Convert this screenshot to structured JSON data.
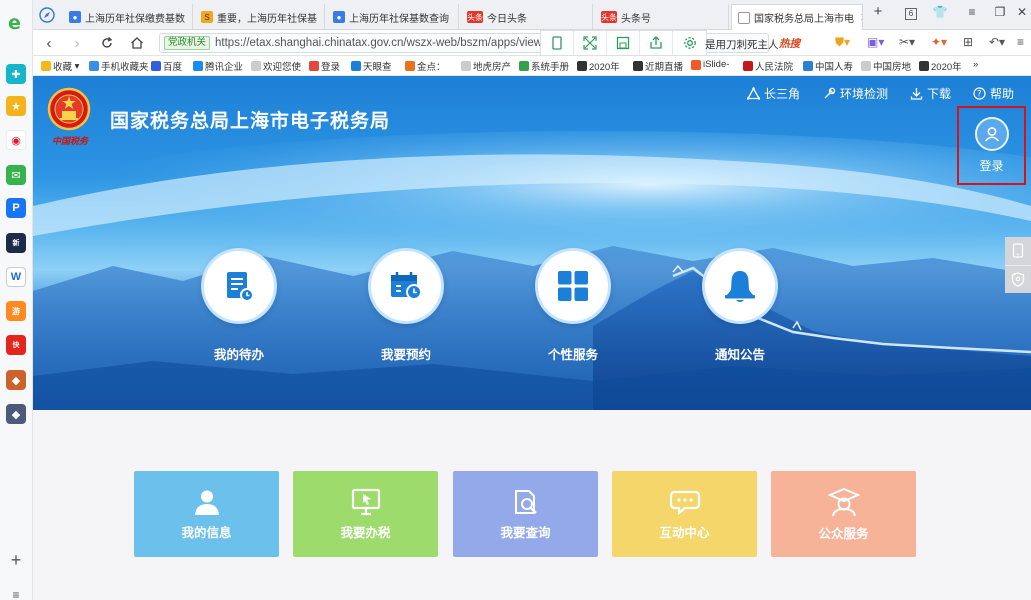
{
  "browser": {
    "tabs": [
      {
        "title": "上海历年社保缴费基数"
      },
      {
        "title": "重要，上海历年社保基"
      },
      {
        "title": "上海历年社保基数查询"
      },
      {
        "title": "今日头条",
        "badge": "头条"
      },
      {
        "title": "头条号",
        "badge": "头条"
      },
      {
        "title": "国家税务总局上海市电"
      }
    ],
    "tab_count": "6",
    "address": {
      "gov_badge": "党政机关",
      "url": "https://etax.shanghai.chinatax.gov.cn/wszx-web/bszm/apps/view",
      "suggestion": "是用刀刺死主人",
      "hot_tag": "热搜"
    },
    "bookmarks": [
      "收藏",
      "手机收藏夹",
      "百度",
      "腾讯企业",
      "欢迎您使",
      "登录",
      "天眼查",
      "金点：",
      "地虎房产",
      "系统手册",
      "2020年",
      "近期直播",
      "iSlide-",
      "人民法院",
      "中国人寿",
      "中国房地",
      "2020年"
    ],
    "bookmarks_more": "»"
  },
  "site": {
    "title": "国家税务总局上海市电子税务局",
    "emblem_caption": "中国税务",
    "top_links": [
      {
        "label": "长三角"
      },
      {
        "label": "环境检测"
      },
      {
        "label": "下载"
      },
      {
        "label": "帮助"
      }
    ],
    "login_label": "登录",
    "services": [
      {
        "label": "我的待办"
      },
      {
        "label": "我要预约"
      },
      {
        "label": "个性服务"
      },
      {
        "label": "通知公告"
      }
    ],
    "tiles": [
      {
        "label": "我的信息",
        "color": "#6cc0ec"
      },
      {
        "label": "我要办税",
        "color": "#9ddc6c"
      },
      {
        "label": "我要查询",
        "color": "#93a9ea"
      },
      {
        "label": "互动中心",
        "color": "#f4d66b"
      },
      {
        "label": "公众服务",
        "color": "#f6b397"
      }
    ]
  },
  "colors": {
    "accent": "#1d80d8",
    "login_highlight": "#d4131b"
  }
}
